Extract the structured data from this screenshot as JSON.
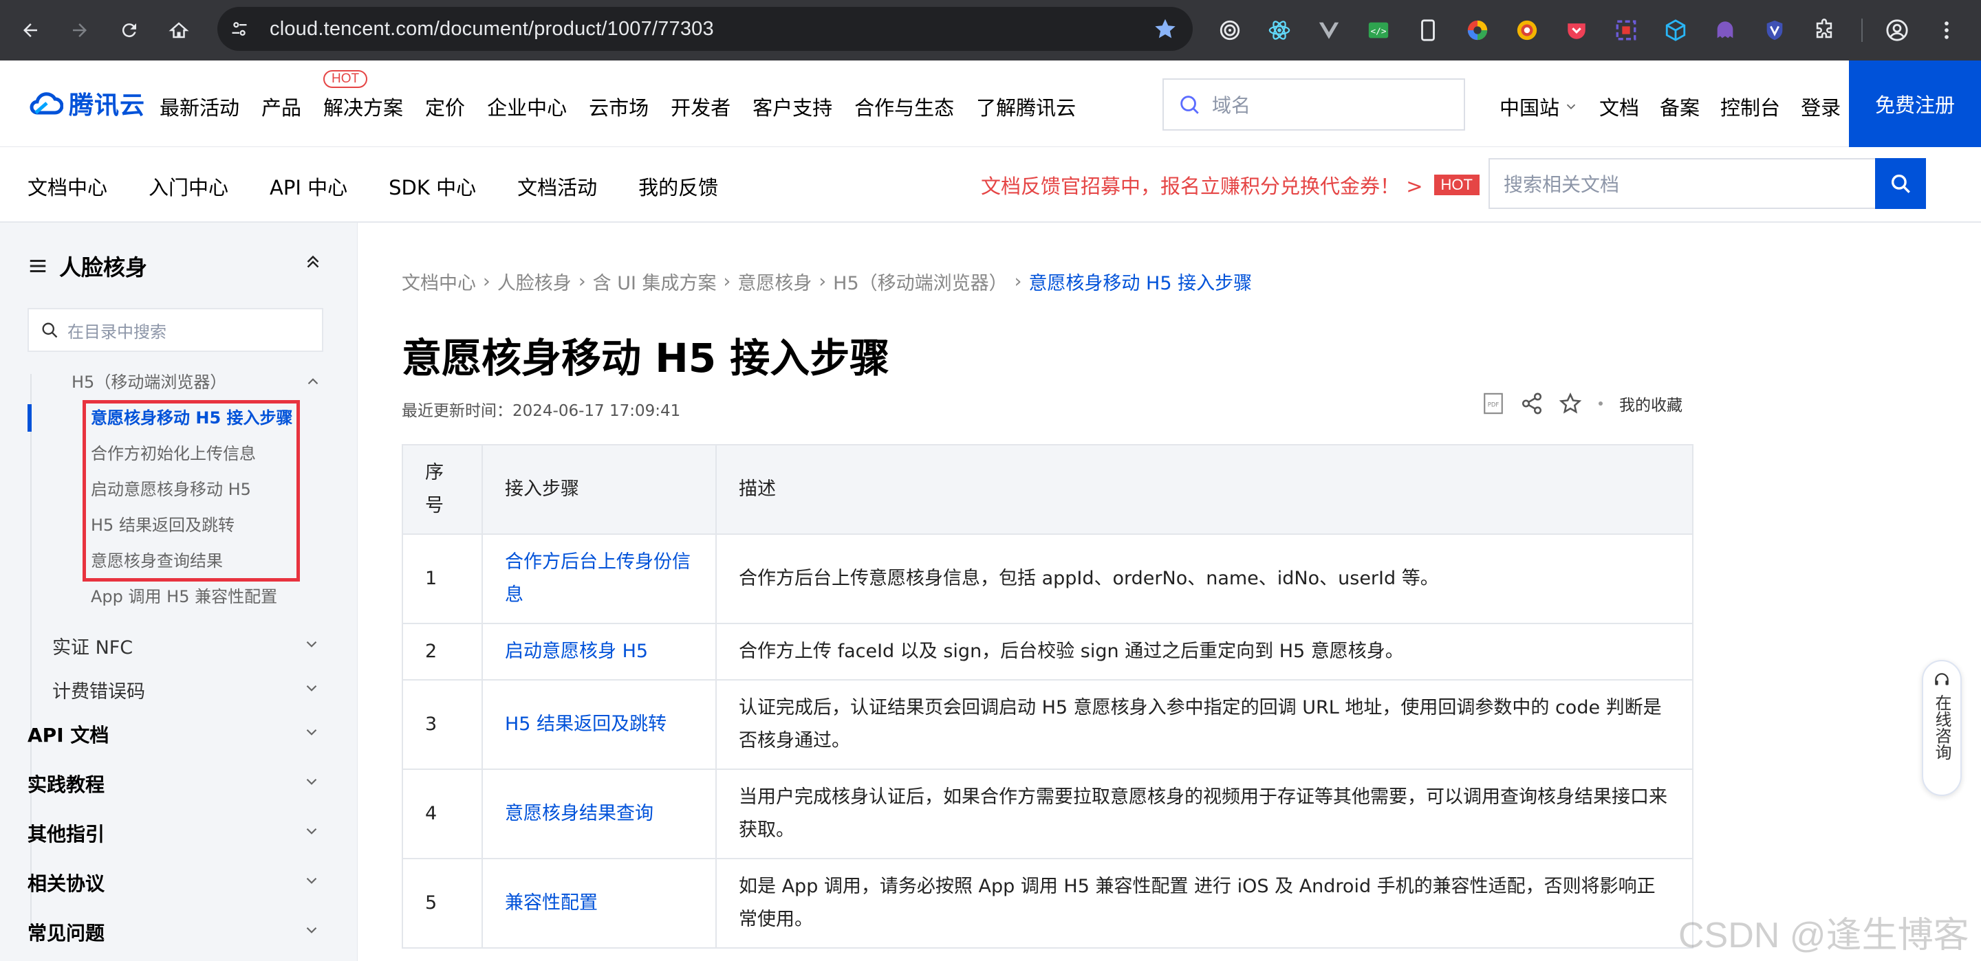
{
  "browser": {
    "url": "cloud.tencent.com/document/product/1007/77303"
  },
  "header": {
    "logo_text": "腾讯云",
    "nav": [
      "最新活动",
      "产品",
      "解决方案",
      "定价",
      "企业中心",
      "云市场",
      "开发者",
      "客户支持",
      "合作与生态",
      "了解腾讯云"
    ],
    "hot_badge": "HOT",
    "search_placeholder": "域名",
    "region": "中国站",
    "links": [
      "文档",
      "备案",
      "控制台",
      "登录"
    ],
    "register": "免费注册"
  },
  "doc_nav": {
    "items": [
      "文档中心",
      "入门中心",
      "API 中心",
      "SDK 中心",
      "文档活动",
      "我的反馈"
    ],
    "promo": "文档反馈官招募中，报名立赚积分兑换代金券！ >",
    "promo_badge": "HOT",
    "search_placeholder": "搜索相关文档"
  },
  "sidebar": {
    "title": "人脸核身",
    "search_placeholder": "在目录中搜索",
    "parent": "H5（移动端浏览器）",
    "sub_items": [
      "意愿核身移动 H5 接入步骤",
      "合作方初始化上传信息",
      "启动意愿核身移动 H5",
      "H5 结果返回及跳转",
      "意愿核身查询结果",
      "App 调用 H5 兼容性配置"
    ],
    "sections": [
      "实证 NFC",
      "计费错误码"
    ],
    "top_items": [
      "API 文档",
      "实践教程",
      "其他指引",
      "相关协议",
      "常见问题"
    ]
  },
  "main": {
    "breadcrumb": [
      "文档中心",
      "人脸核身",
      "含 UI 集成方案",
      "意愿核身",
      "H5（移动端浏览器）",
      "意愿核身移动 H5 接入步骤"
    ],
    "title": "意愿核身移动 H5 接入步骤",
    "update_time": "最近更新时间：2024-06-17 17:09:41",
    "favorites": "我的收藏",
    "table": {
      "headers": [
        "序号",
        "接入步骤",
        "描述"
      ],
      "rows": [
        {
          "no": "1",
          "step": "合作方后台上传身份信息",
          "desc": "合作方后台上传意愿核身信息，包括 appId、orderNo、name、idNo、userId 等。"
        },
        {
          "no": "2",
          "step": "启动意愿核身 H5",
          "desc": "合作方上传 faceId 以及 sign，后台校验 sign 通过之后重定向到 H5 意愿核身。"
        },
        {
          "no": "3",
          "step": "H5 结果返回及跳转",
          "desc": "认证完成后，认证结果页会回调启动 H5 意愿核身入参中指定的回调 URL 地址，使用回调参数中的 code 判断是否核身通过。"
        },
        {
          "no": "4",
          "step": "意愿核身结果查询",
          "desc": "当用户完成核身认证后，如果合作方需要拉取意愿核身的视频用于存证等其他需要，可以调用查询核身结果接口来获取。"
        },
        {
          "no": "5",
          "step": "兼容性配置",
          "desc": "如是 App 调用，请务必按照 App 调用 H5 兼容性配置 进行 iOS 及 Android 手机的兼容性适配，否则将影响正常使用。"
        }
      ]
    }
  },
  "float": {
    "consult": "在线咨询"
  },
  "watermark": "CSDN @逢生博客"
}
